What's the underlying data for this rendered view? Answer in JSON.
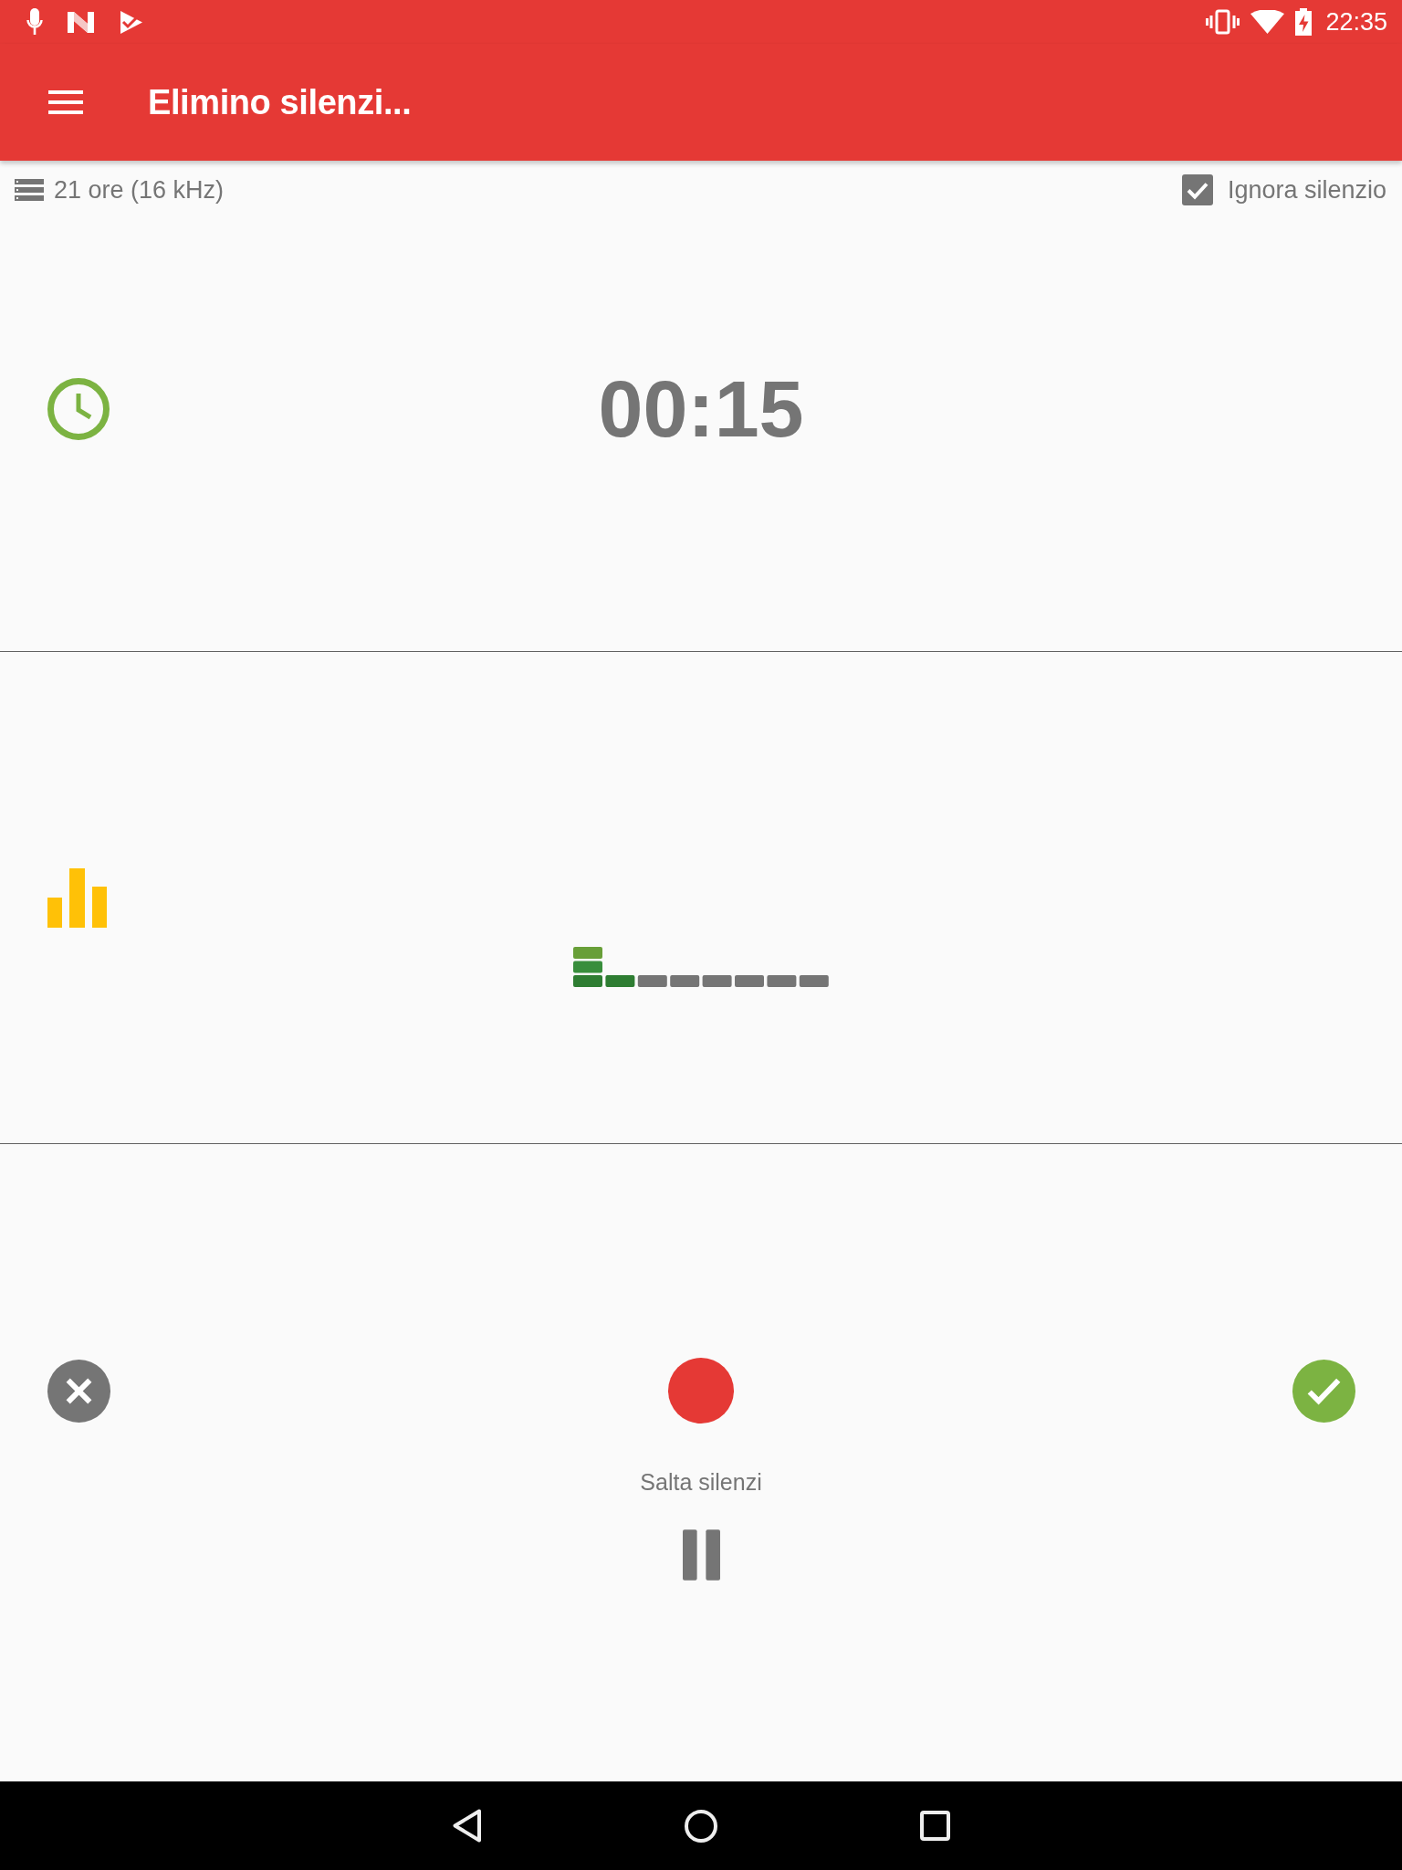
{
  "status_bar": {
    "time": "22:35"
  },
  "app_bar": {
    "title": "Elimino silenzi..."
  },
  "info_row": {
    "storage": "21 ore (16 kHz)",
    "ignore_silence": {
      "label": "Ignora silenzio",
      "checked": true
    }
  },
  "timer": {
    "elapsed": "00:15"
  },
  "controls": {
    "skip_label": "Salta silenzi"
  }
}
